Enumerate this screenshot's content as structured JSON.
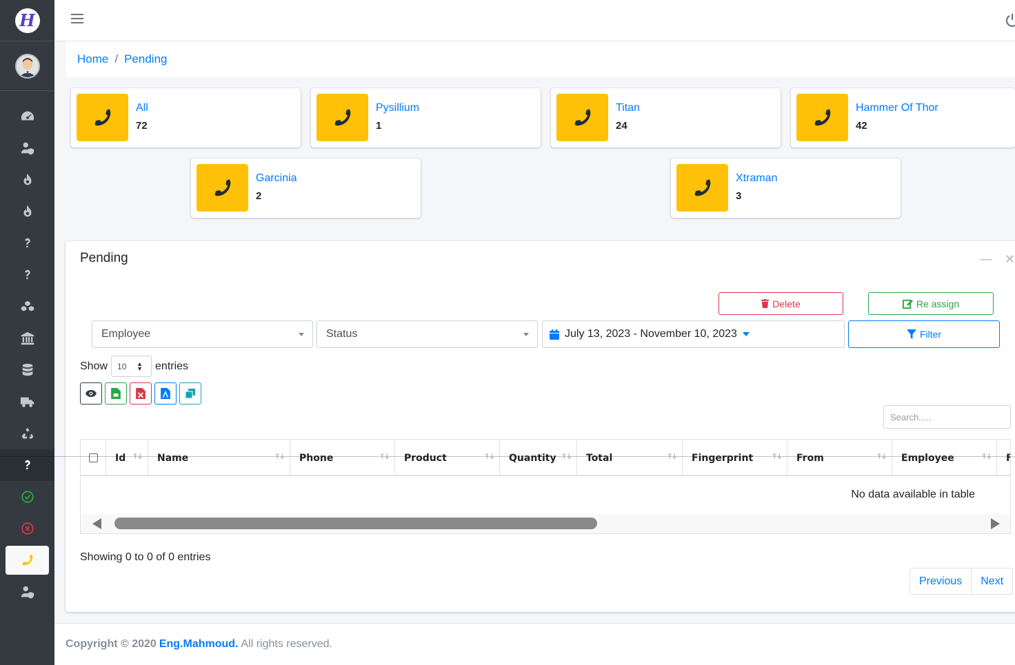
{
  "brand": {
    "logo_letter": "H"
  },
  "breadcrumb": {
    "home": "Home",
    "current": "Pending"
  },
  "stats": [
    {
      "title": "All",
      "count": "72"
    },
    {
      "title": "Pysillium",
      "count": "1"
    },
    {
      "title": "Titan",
      "count": "24"
    },
    {
      "title": "Hammer Of Thor",
      "count": "42"
    },
    {
      "title": "Garcinia",
      "count": "2"
    },
    {
      "title": "Xtraman",
      "count": "3"
    }
  ],
  "card": {
    "title": "Pending",
    "delete_label": "Delete",
    "reassign_label": "Re assign",
    "filter_label": "Filter",
    "employee_select": "Employee",
    "status_select": "Status",
    "date_range": "July 13, 2023 - November 10, 2023",
    "show_label": "Show",
    "entries_label": "entries",
    "page_length": "10",
    "search_placeholder": "Search.....",
    "columns": [
      "Id",
      "Name",
      "Phone",
      "Product",
      "Quantity",
      "Total",
      "Fingerprint",
      "From",
      "Employee",
      "F"
    ],
    "empty_message": "No data available in table",
    "info": "Showing 0 to 0 of 0 entries",
    "prev_label": "Previous",
    "next_label": "Next"
  },
  "footer": {
    "prefix": "Copyright © 2020",
    "author": "Eng.Mahmoud.",
    "suffix": "All rights reserved."
  },
  "colors": {
    "accent": "#007bff",
    "warning": "#ffc107",
    "sidebar": "#343a40"
  }
}
